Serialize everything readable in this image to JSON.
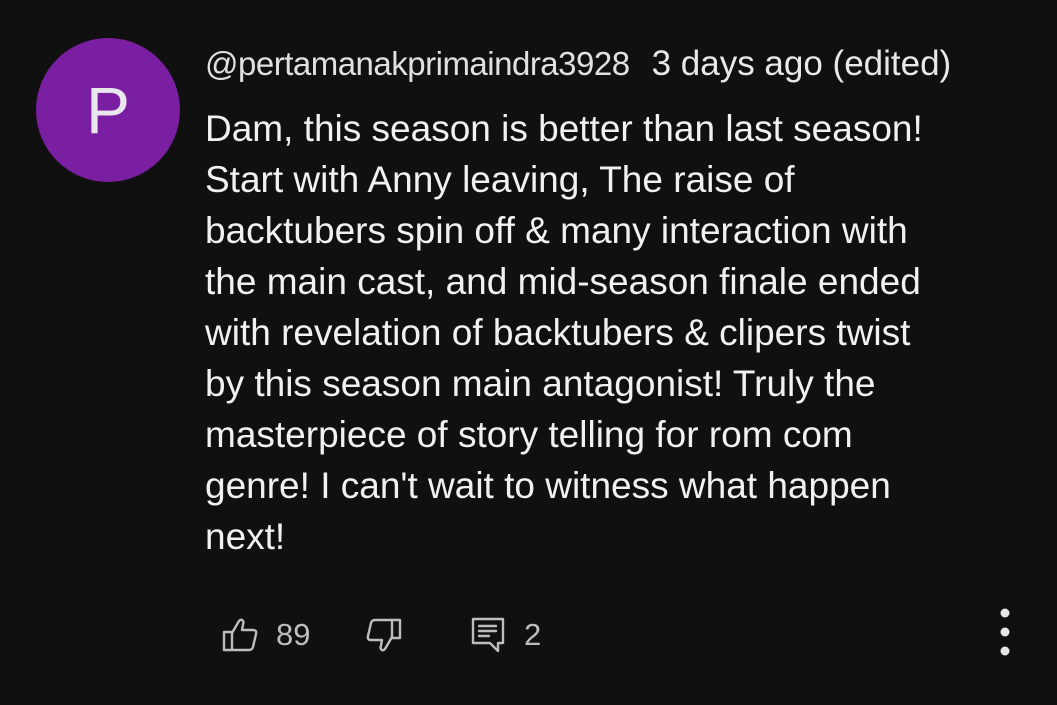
{
  "avatar": {
    "letter": "P",
    "color": "#7b1fa2"
  },
  "comment": {
    "author": "@pertamanakprimaindra3928",
    "time": "3 days ago (edited)",
    "text": "Dam, this season is better than last season!\nStart with Anny leaving, The raise of\nbacktubers spin off & many interaction with\nthe main cast, and mid-season finale ended\nwith  revelation of backtubers & clipers twist\nby this season main antagonist! Truly the\nmasterpiece of story telling for rom com\ngenre! I can't wait to witness what happen\nnext!"
  },
  "actions": {
    "like_icon": "thumbs-up-icon",
    "like_count": "89",
    "dislike_icon": "thumbs-down-icon",
    "reply_icon": "comment-icon",
    "reply_count": "2",
    "more_icon": "vertical-ellipsis-icon"
  },
  "colors": {
    "background": "#101010",
    "text": "#f1f1f1",
    "secondary_text": "#bdbdbd"
  }
}
